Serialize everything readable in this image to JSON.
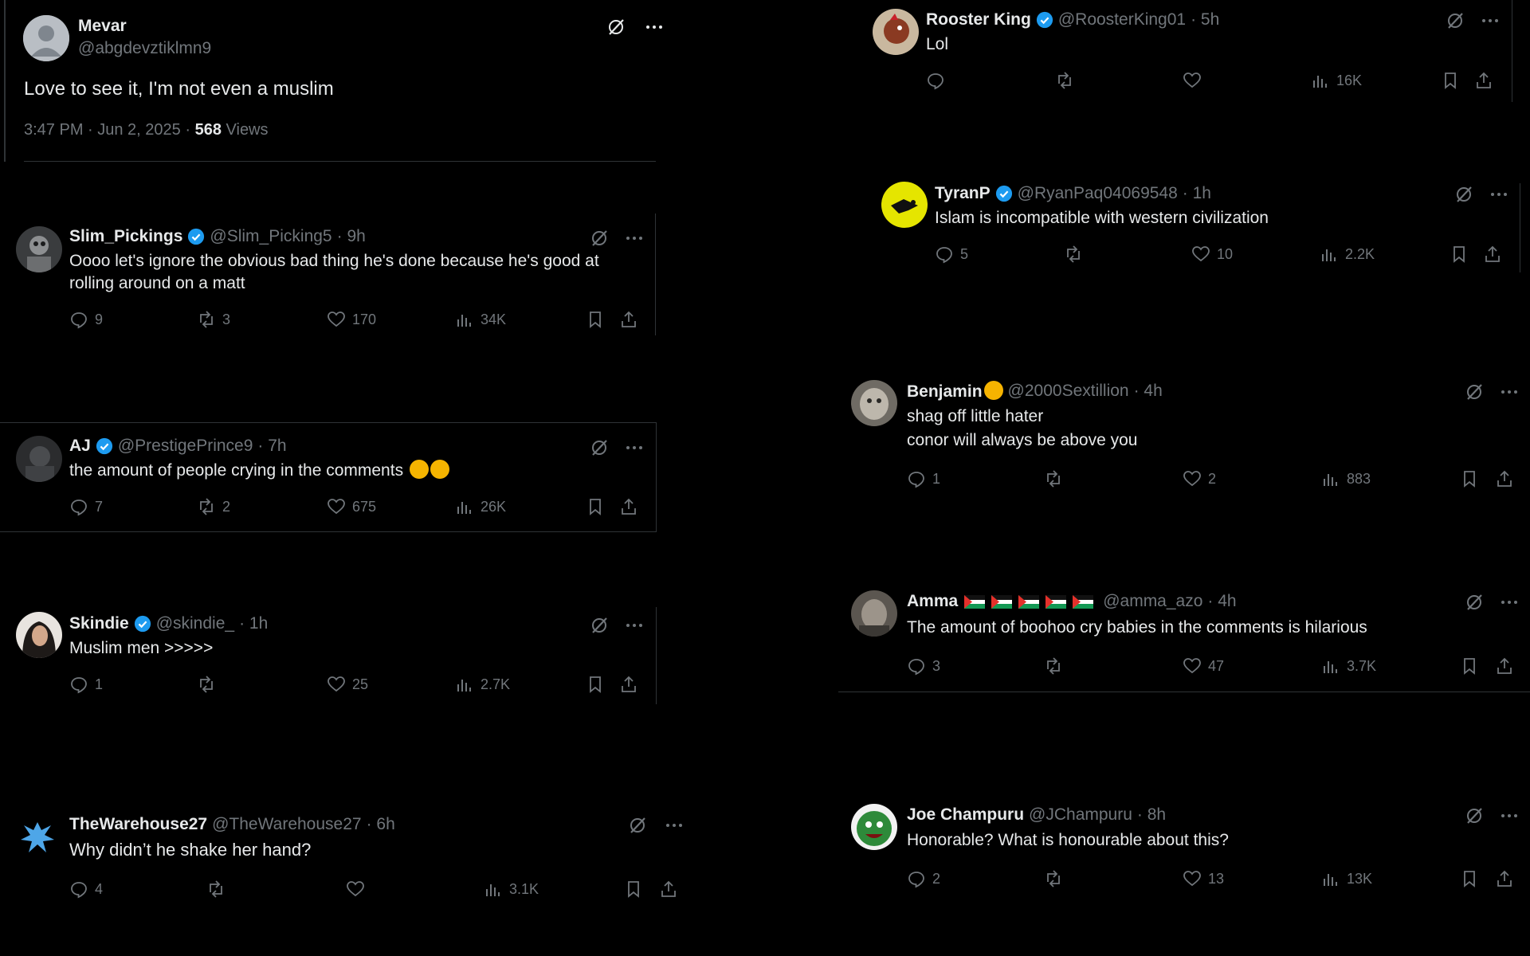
{
  "main_post": {
    "name": "Mevar",
    "handle": "@abgdevztiklmn9",
    "text": "Love to see it, I'm not even a muslim",
    "timestamp": "3:47 PM · Jun 2, 2025 ·",
    "views_count": "568",
    "views_label": "Views"
  },
  "icons": {
    "reply": "reply-icon",
    "repost": "repost-icon",
    "like": "like-icon",
    "views": "views-icon",
    "bookmark": "bookmark-icon",
    "share": "share-icon",
    "grok": "grok-icon",
    "more": "more-icon",
    "verified": "verified-badge-icon"
  },
  "colors": {
    "background": "#000000",
    "text": "#e7e9ea",
    "muted": "#71767b",
    "verified": "#1d9bf0",
    "divider": "#2f3336"
  },
  "left_replies": [
    {
      "name": "Slim_Pickings",
      "handle": "@Slim_Picking5",
      "time": "· 9h",
      "text_lines": [
        "Oooo let's ignore the obvious bad thing he's done because he's good at",
        "rolling around on a matt"
      ],
      "replies": "9",
      "reposts": "3",
      "likes": "170",
      "views": "34K"
    },
    {
      "name": "AJ",
      "handle": "@PrestigePrince9",
      "time": "· 7h",
      "text_lines": [
        "the amount of people crying in the comments"
      ],
      "replies": "7",
      "reposts": "2",
      "likes": "675",
      "views": "26K"
    },
    {
      "name": "Skindie",
      "handle": "@skindie_",
      "time": "· 1h",
      "text_lines": [
        "Muslim men >>>>>"
      ],
      "replies": "1",
      "reposts": "",
      "likes": "25",
      "views": "2.7K"
    },
    {
      "name": "TheWarehouse27",
      "handle": "@TheWarehouse27",
      "time": "· 6h",
      "text_lines": [
        "Why didn’t he shake her hand?"
      ],
      "replies": "4",
      "reposts": "",
      "likes": "",
      "views": "3.1K"
    }
  ],
  "right_replies": [
    {
      "name": "Rooster King",
      "handle": "@RoosterKing01",
      "time": "· 5h",
      "text_lines": [
        "Lol"
      ],
      "replies": "",
      "reposts": "",
      "likes": "",
      "views": "16K"
    },
    {
      "name": "TyranP",
      "handle": "@RyanPaq04069548",
      "time": "· 1h",
      "text_lines": [
        "Islam is incompatible with western civilization"
      ],
      "replies": "5",
      "reposts": "",
      "likes": "10",
      "views": "2.2K"
    },
    {
      "name": "Benjamin",
      "handle": "@2000Sextillion",
      "time": "· 4h",
      "text_lines": [
        "shag off little hater",
        "conor will always be above you"
      ],
      "replies": "1",
      "reposts": "",
      "likes": "2",
      "views": "883"
    },
    {
      "name": "Amma",
      "handle": "@amma_azo",
      "time": "· 4h",
      "text_lines": [
        "The amount of boohoo cry babies in the comments is hilarious"
      ],
      "replies": "3",
      "reposts": "",
      "likes": "47",
      "views": "3.7K"
    },
    {
      "name": "Joe Champuru",
      "handle": "@JChampuru",
      "time": "· 8h",
      "text_lines": [
        "Honorable? What is honourable about this?"
      ],
      "replies": "2",
      "reposts": "",
      "likes": "13",
      "views": "13K"
    }
  ]
}
